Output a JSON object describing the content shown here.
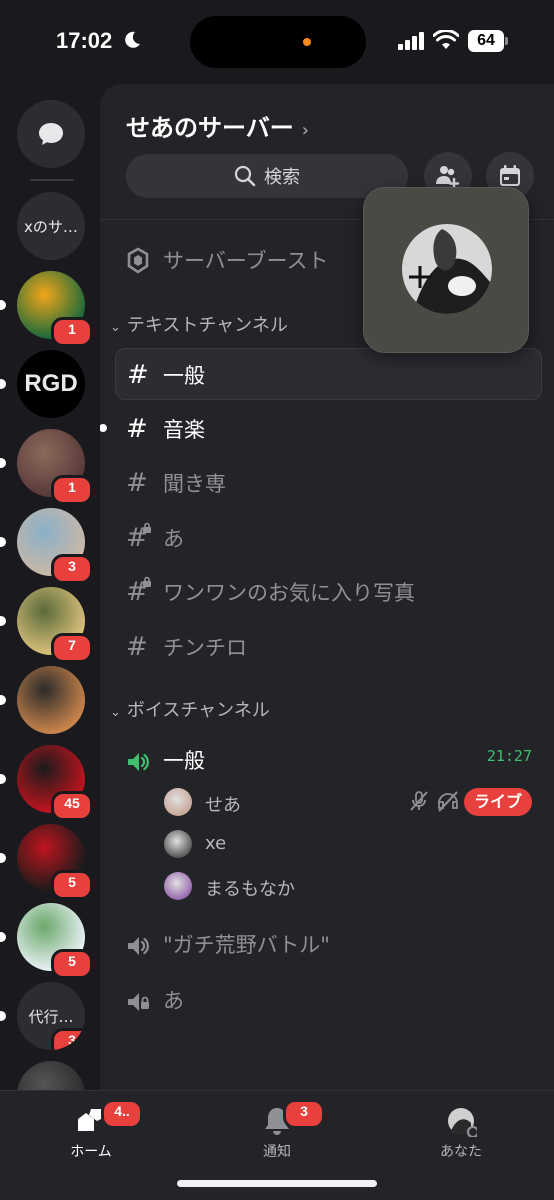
{
  "status_bar": {
    "time": "17:02",
    "battery": "64"
  },
  "rail": {
    "dm_label": "ダイレクトメッセージ",
    "items": [
      {
        "type": "text",
        "label": "xのサ…",
        "badge": "",
        "unread": false
      },
      {
        "type": "image",
        "label": "",
        "badge": "1",
        "unread": true,
        "colors": [
          "#1c6b3a",
          "#f2a51a"
        ]
      },
      {
        "type": "text",
        "label": "RGD",
        "badge": "",
        "unread": true
      },
      {
        "type": "image",
        "label": "",
        "badge": "1",
        "unread": true,
        "colors": [
          "#5a3a3a",
          "#8a6a5a"
        ]
      },
      {
        "type": "image",
        "label": "",
        "badge": "3",
        "unread": true,
        "colors": [
          "#c9b8a8",
          "#8ab0c8"
        ]
      },
      {
        "type": "image",
        "label": "",
        "badge": "7",
        "unread": true,
        "colors": [
          "#d9c07a",
          "#5a6a3a"
        ]
      },
      {
        "type": "image",
        "label": "",
        "badge": "",
        "unread": true,
        "colors": [
          "#c8834a",
          "#2b2b2b"
        ]
      },
      {
        "type": "image",
        "label": "",
        "badge": "45",
        "unread": true,
        "colors": [
          "#c0141e",
          "#1b1b1b"
        ]
      },
      {
        "type": "image",
        "label": "",
        "badge": "5",
        "unread": true,
        "colors": [
          "#1b1b1b",
          "#c0141e"
        ]
      },
      {
        "type": "image",
        "label": "",
        "badge": "5",
        "unread": true,
        "colors": [
          "#e8f0f4",
          "#6aa86a"
        ]
      },
      {
        "type": "text",
        "label": "代行…",
        "badge": "3",
        "unread": true
      },
      {
        "type": "image",
        "label": "",
        "badge": "",
        "unread": true,
        "colors": [
          "#2a2a2a",
          "#555555"
        ]
      }
    ]
  },
  "server": {
    "name": "せあのサーバー",
    "chevron": "›",
    "search_label": "検索"
  },
  "boost": {
    "label": "サーバーブースト"
  },
  "text_category": {
    "label": "テキストチャンネル"
  },
  "text_channels": [
    {
      "name": "一般",
      "state": "active",
      "icon": "#",
      "locked": false
    },
    {
      "name": "音楽",
      "state": "unread",
      "icon": "#",
      "locked": false
    },
    {
      "name": "聞き専",
      "state": "normal",
      "icon": "#",
      "locked": false
    },
    {
      "name": "あ",
      "state": "normal",
      "icon": "#",
      "locked": true
    },
    {
      "name": "ワンワンのお気に入り写真",
      "state": "normal",
      "icon": "#",
      "locked": true
    },
    {
      "name": "チンチロ",
      "state": "normal",
      "icon": "#",
      "locked": false
    }
  ],
  "voice_category": {
    "label": "ボイスチャンネル"
  },
  "voice_channels": [
    {
      "name": "一般",
      "time": "21:27",
      "members": [
        {
          "name": "せあ",
          "live": "ライブ",
          "avatar_color": "#c9a89a"
        },
        {
          "name": "xe",
          "live": "",
          "avatar_color": "#5a5a5a"
        },
        {
          "name": "まるもなか",
          "live": "",
          "avatar_color": "#9a6ab0"
        }
      ]
    },
    {
      "name": "\"ガチ荒野バトル\"",
      "time": "",
      "members": []
    },
    {
      "name": "あ",
      "time": "",
      "members": []
    }
  ],
  "tabbar": {
    "home": {
      "label": "ホーム",
      "badge": "4.."
    },
    "notifications": {
      "label": "通知",
      "badge": "3"
    },
    "you": {
      "label": "あなた"
    }
  },
  "colors": {
    "accent_green": "#3fbf6f",
    "badge_red": "#e8403c",
    "panel": "#232428",
    "rail": "#1a1a1e"
  }
}
